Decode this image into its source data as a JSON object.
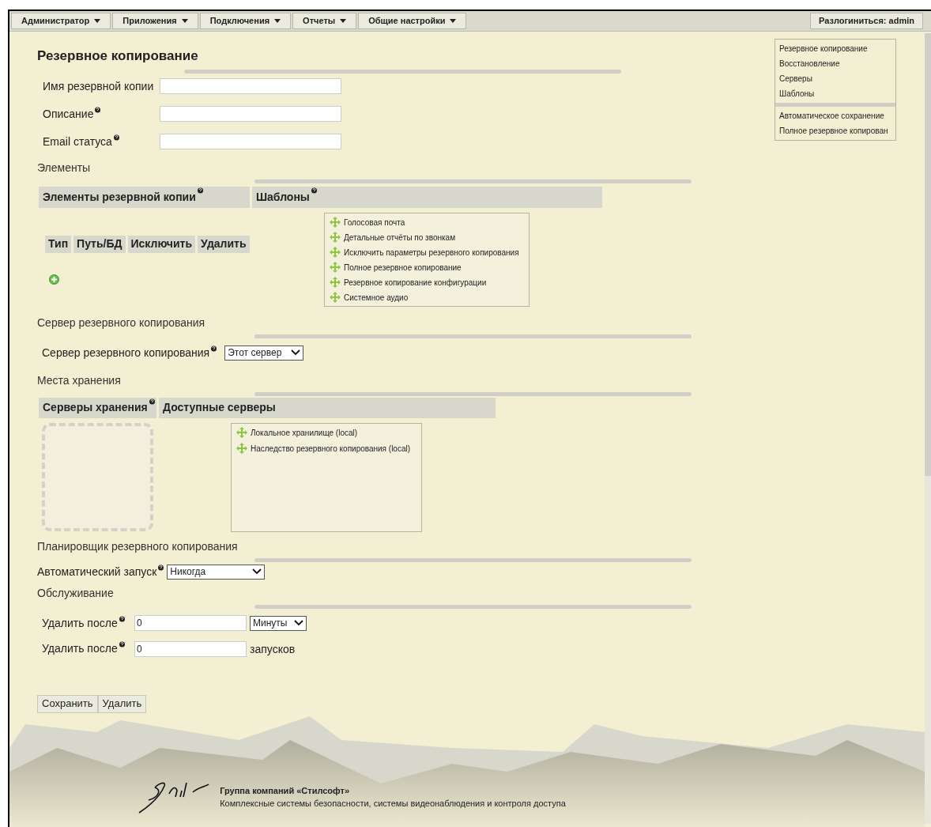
{
  "menu": [
    {
      "label": "Администратор"
    },
    {
      "label": "Приложения"
    },
    {
      "label": "Подключения"
    },
    {
      "label": "Отчеты"
    },
    {
      "label": "Общие настройки"
    }
  ],
  "logout": "Разлогиниться: admin",
  "title": "Резервное копирование",
  "fields": [
    {
      "label": "Имя резервной копии",
      "help": false
    },
    {
      "label": "Описание",
      "help": true
    },
    {
      "label": "Email статуса",
      "help": true
    }
  ],
  "side_menu": [
    [
      "Резервное копирование",
      "Восстановление",
      "Серверы",
      "Шаблоны"
    ],
    [
      "Автоматическое сохранение",
      "Полное резервное копирован"
    ]
  ],
  "elements": {
    "heading": "Элементы",
    "col_items": "Элементы резервной копии",
    "col_templates": "Шаблоны",
    "item_columns": [
      "Тип",
      "Путь/БД",
      "Исключить",
      "Удалить"
    ],
    "templates": [
      "Голосовая почта",
      "Детальные отчёты по звонкам",
      "Исключить параметры резервного копирования",
      "Полное резервное копирование",
      "Резервное копирование конфигурации",
      "Системное аудио"
    ]
  },
  "server": {
    "heading": "Сервер резервного копирования",
    "label": "Сервер резервного копирования",
    "value": "Этот сервер"
  },
  "storage": {
    "heading": "Места хранения",
    "col_storage": "Серверы хранения",
    "col_available": "Доступные серверы",
    "available": [
      "Локальное хранилище (local)",
      "Наследство резервного копирования (local)"
    ]
  },
  "scheduler": {
    "heading": "Планировщик резервного копирования",
    "label": "Автоматический запуск",
    "value": "Никогда"
  },
  "maintenance": {
    "heading": "Обслуживание",
    "rows": [
      {
        "kind": "select",
        "label": "Удалить после",
        "value": "0",
        "unit": "Минуты"
      },
      {
        "kind": "text",
        "label": "Удалить после",
        "value": "0",
        "unit": "запусков"
      }
    ]
  },
  "buttons": [
    "Сохранить",
    "Удалить"
  ],
  "footer": {
    "company": "Группа компаний «Стилсофт»",
    "tagline": "Комплексные системы безопасности, системы видеонаблюдения и контроля доступа"
  }
}
